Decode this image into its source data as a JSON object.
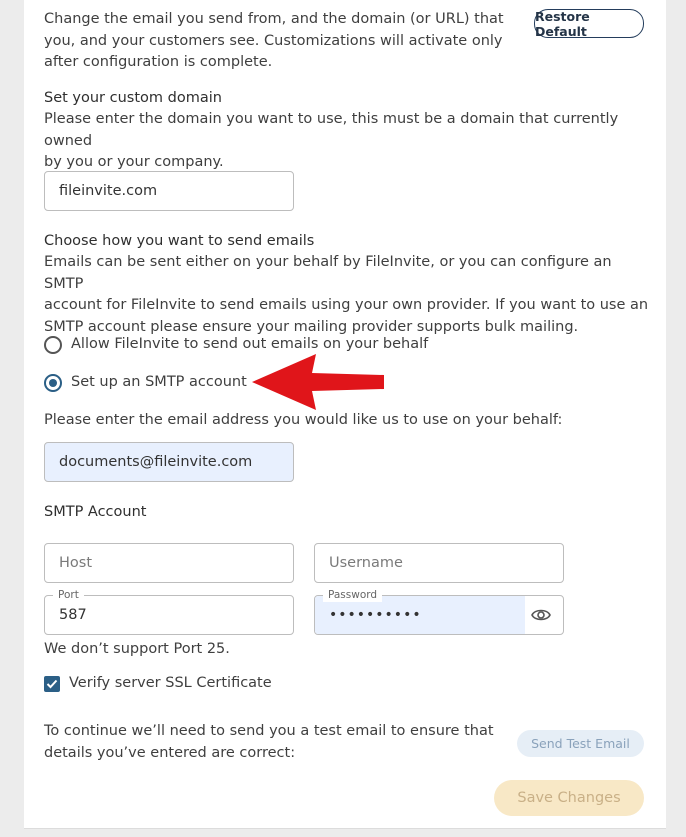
{
  "intro": {
    "lines": [
      "Change the email you send from, and the domain (or URL) that",
      "you, and your customers see. Customizations will activate only",
      "after configuration is complete."
    ],
    "restore_label": "Restore Default"
  },
  "domain": {
    "heading": "Set your custom domain",
    "lines": [
      "Please enter the domain you want to use, this must be a domain that currently owned",
      "by you or your company."
    ],
    "value": "fileinvite.com"
  },
  "send": {
    "heading": "Choose how you want to send emails",
    "lines": [
      "Emails can be sent either on your behalf by FileInvite, or you can configure an SMTP",
      "account for FileInvite to send emails using your own provider. If you want to use an",
      "SMTP account please ensure your mailing provider supports bulk mailing."
    ],
    "option_behalf": "Allow FileInvite to send out emails on your behalf",
    "option_smtp": "Set up an SMTP account",
    "selected": "smtp"
  },
  "email": {
    "prompt": "Please enter the email address you would like us to use on your behalf:",
    "value": "documents@fileinvite.com"
  },
  "smtp": {
    "heading": "SMTP Account",
    "host_placeholder": "Host",
    "username_placeholder": "Username",
    "port_label": "Port",
    "port_value": "587",
    "password_label": "Password",
    "password_value": "••••••••••",
    "port_note": "We don’t support Port 25.",
    "ssl_label": "Verify server SSL Certificate",
    "ssl_checked": true
  },
  "test": {
    "lines": [
      "To continue we’ll need to send you a test email to ensure that",
      "details you’ve entered are correct:"
    ],
    "button_label": "Send Test Email"
  },
  "save_label": "Save Changes",
  "icons": {
    "password_toggle": "eye-icon",
    "annotation": "red-arrow-icon",
    "checkbox": "check-icon"
  },
  "colors": {
    "accent": "#2b5f86",
    "arrow": "#e0151a",
    "save_bg": "#f8e8c6",
    "filled_input_bg": "#e8f0fe"
  }
}
